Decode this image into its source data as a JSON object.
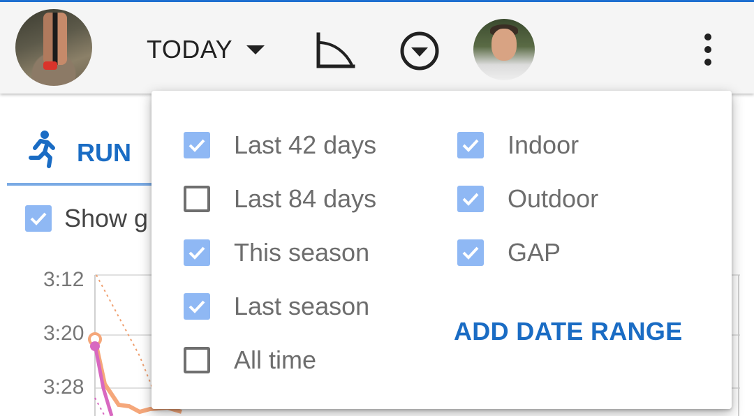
{
  "topbar": {
    "period_label": "TODAY",
    "accent_color": "#1e6fd0",
    "icons": [
      "profile-photo",
      "curve-chart-icon",
      "filter-circle-icon",
      "athlete-photo",
      "more-vert-icon"
    ]
  },
  "tab": {
    "label": "RUN",
    "icon": "runner-icon",
    "color": "#1a6cc4"
  },
  "show_checkbox": {
    "label": "Show g",
    "checked": true
  },
  "chart": {
    "y_ticks": [
      "3:12",
      "3:20",
      "3:28"
    ]
  },
  "dropdown": {
    "date_options": [
      {
        "label": "Last 42 days",
        "checked": true
      },
      {
        "label": "Last 84 days",
        "checked": false
      },
      {
        "label": "This season",
        "checked": true
      },
      {
        "label": "Last season",
        "checked": true
      },
      {
        "label": "All time",
        "checked": false
      }
    ],
    "type_options": [
      {
        "label": "Indoor",
        "checked": true
      },
      {
        "label": "Outdoor",
        "checked": true
      },
      {
        "label": "GAP",
        "checked": true
      }
    ],
    "add_range_label": "ADD DATE RANGE",
    "checked_color": "#8fb8f4"
  }
}
